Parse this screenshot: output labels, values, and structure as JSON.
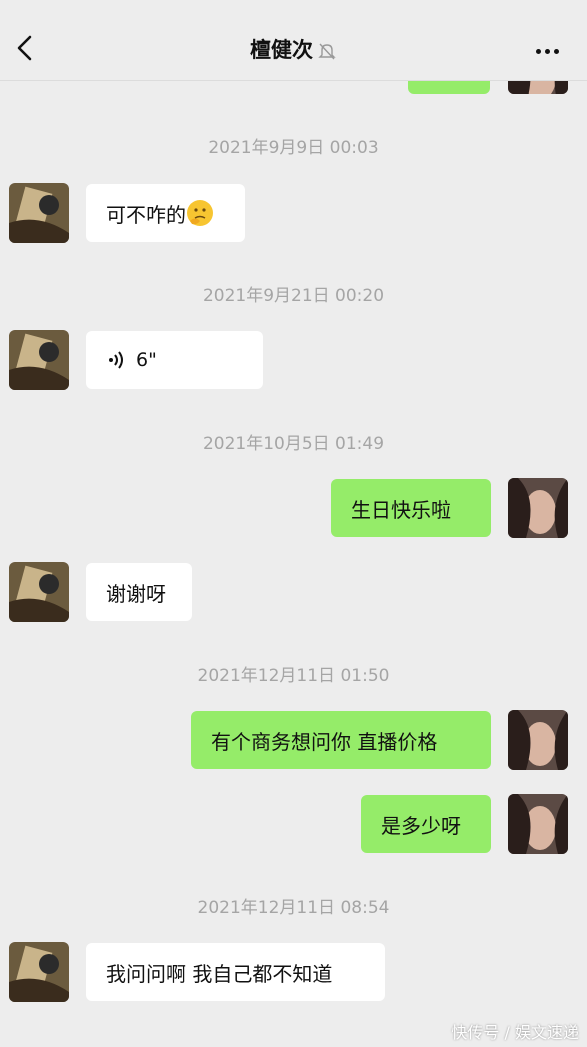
{
  "header": {
    "title": "檀健次",
    "back_icon": "chevron-left-icon",
    "mute_icon": "bell-slash-icon",
    "more_icon": "more-dots-icon"
  },
  "messages": [
    {
      "type": "timestamp",
      "text": "2021年9月9日 00:03"
    },
    {
      "type": "incoming",
      "text": "可不咋的",
      "emoji": "thinking-face-emoji"
    },
    {
      "type": "timestamp",
      "text": "2021年9月21日 00:20"
    },
    {
      "type": "incoming_voice",
      "text": "6\"",
      "icon": "voice-wave-icon"
    },
    {
      "type": "timestamp",
      "text": "2021年10月5日 01:49"
    },
    {
      "type": "outgoing",
      "text": "生日快乐啦"
    },
    {
      "type": "incoming",
      "text": "谢谢呀"
    },
    {
      "type": "timestamp",
      "text": "2021年12月11日 01:50"
    },
    {
      "type": "outgoing",
      "text": "有个商务想问你 直播价格"
    },
    {
      "type": "outgoing",
      "text": "是多少呀"
    },
    {
      "type": "timestamp",
      "text": "2021年12月11日 08:54"
    },
    {
      "type": "incoming",
      "text": "我问问啊 我自己都不知道"
    }
  ],
  "watermark": "快传号 / 娱文速递",
  "colors": {
    "background": "#ededed",
    "outgoing_bubble": "#95ec69",
    "incoming_bubble": "#ffffff",
    "timestamp": "#a5a5a5"
  }
}
